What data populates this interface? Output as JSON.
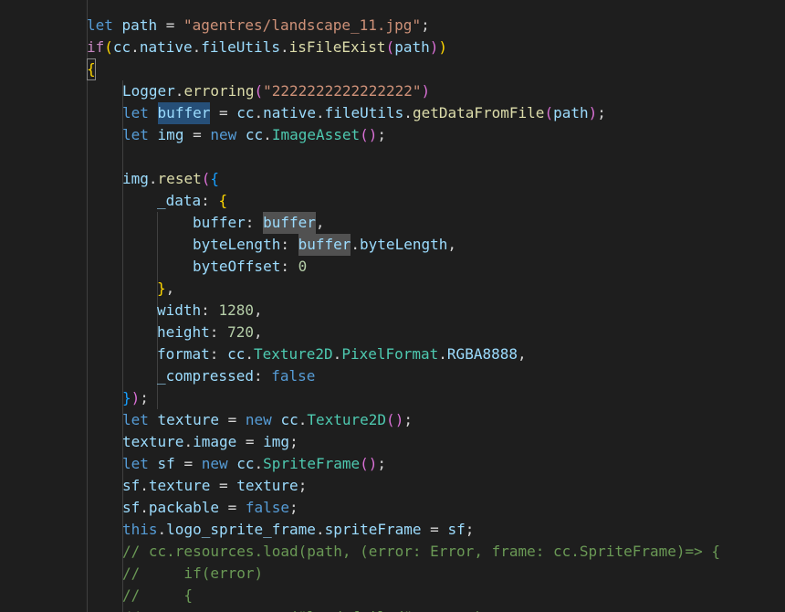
{
  "editor": {
    "background": "#1e1e1e",
    "lines": [
      {
        "indent": 1,
        "tokens": [
          [
            "let",
            "kw"
          ],
          [
            " ",
            "pun"
          ],
          [
            "path",
            "var"
          ],
          [
            " = ",
            "pun"
          ],
          [
            "\"agentres/landscape_11.jpg\"",
            "str"
          ],
          [
            ";",
            "pun"
          ]
        ]
      },
      {
        "indent": 1,
        "tokens": [
          [
            "if",
            "ctl"
          ],
          [
            "(",
            "br1"
          ],
          [
            "cc",
            "var"
          ],
          [
            ".",
            "pun"
          ],
          [
            "native",
            "var"
          ],
          [
            ".",
            "pun"
          ],
          [
            "fileUtils",
            "var"
          ],
          [
            ".",
            "pun"
          ],
          [
            "isFileExist",
            "fn"
          ],
          [
            "(",
            "br2"
          ],
          [
            "path",
            "var"
          ],
          [
            ")",
            "br2"
          ],
          [
            ")",
            "br1"
          ]
        ]
      },
      {
        "indent": 1,
        "tokens": [
          [
            "{",
            "br1 brace-box"
          ]
        ]
      },
      {
        "indent": 2,
        "tokens": [
          [
            "Logger",
            "var"
          ],
          [
            ".",
            "pun"
          ],
          [
            "erroring",
            "fn"
          ],
          [
            "(",
            "br2"
          ],
          [
            "\"2222222222222222\"",
            "str"
          ],
          [
            ")",
            "br2"
          ]
        ]
      },
      {
        "indent": 2,
        "tokens": [
          [
            "let",
            "kw"
          ],
          [
            " ",
            "pun"
          ],
          [
            "buffer",
            "var hl-sel"
          ],
          [
            " = ",
            "pun"
          ],
          [
            "cc",
            "var"
          ],
          [
            ".",
            "pun"
          ],
          [
            "native",
            "var"
          ],
          [
            ".",
            "pun"
          ],
          [
            "fileUtils",
            "var"
          ],
          [
            ".",
            "pun"
          ],
          [
            "getDataFromFile",
            "fn"
          ],
          [
            "(",
            "br2"
          ],
          [
            "path",
            "var"
          ],
          [
            ")",
            "br2"
          ],
          [
            ";",
            "pun"
          ]
        ]
      },
      {
        "indent": 2,
        "tokens": [
          [
            "let",
            "kw"
          ],
          [
            " ",
            "pun"
          ],
          [
            "img",
            "var"
          ],
          [
            " = ",
            "pun"
          ],
          [
            "new",
            "kw"
          ],
          [
            " ",
            "pun"
          ],
          [
            "cc",
            "var"
          ],
          [
            ".",
            "pun"
          ],
          [
            "ImageAsset",
            "cls"
          ],
          [
            "(",
            "br2"
          ],
          [
            ")",
            "br2"
          ],
          [
            ";",
            "pun"
          ]
        ]
      },
      {
        "indent": 2,
        "tokens": []
      },
      {
        "indent": 2,
        "tokens": [
          [
            "img",
            "var"
          ],
          [
            ".",
            "pun"
          ],
          [
            "reset",
            "fn"
          ],
          [
            "(",
            "br2"
          ],
          [
            "{",
            "br3"
          ]
        ]
      },
      {
        "indent": 3,
        "tokens": [
          [
            "_data",
            "var"
          ],
          [
            ": ",
            "pun"
          ],
          [
            "{",
            "br1"
          ]
        ]
      },
      {
        "indent": 4,
        "tokens": [
          [
            "buffer",
            "var"
          ],
          [
            ": ",
            "pun"
          ],
          [
            "buffer",
            "var hl-occ"
          ],
          [
            ",",
            "pun"
          ]
        ]
      },
      {
        "indent": 4,
        "tokens": [
          [
            "byteLength",
            "var"
          ],
          [
            ": ",
            "pun"
          ],
          [
            "buffer",
            "var hl-occ"
          ],
          [
            ".",
            "pun"
          ],
          [
            "byteLength",
            "var"
          ],
          [
            ",",
            "pun"
          ]
        ]
      },
      {
        "indent": 4,
        "tokens": [
          [
            "byteOffset",
            "var"
          ],
          [
            ": ",
            "pun"
          ],
          [
            "0",
            "num"
          ]
        ]
      },
      {
        "indent": 3,
        "tokens": [
          [
            "}",
            "br1"
          ],
          [
            ",",
            "pun"
          ]
        ]
      },
      {
        "indent": 3,
        "tokens": [
          [
            "width",
            "var"
          ],
          [
            ": ",
            "pun"
          ],
          [
            "1280",
            "num"
          ],
          [
            ",",
            "pun"
          ]
        ]
      },
      {
        "indent": 3,
        "tokens": [
          [
            "height",
            "var"
          ],
          [
            ": ",
            "pun"
          ],
          [
            "720",
            "num"
          ],
          [
            ",",
            "pun"
          ]
        ]
      },
      {
        "indent": 3,
        "tokens": [
          [
            "format",
            "var"
          ],
          [
            ": ",
            "pun"
          ],
          [
            "cc",
            "var"
          ],
          [
            ".",
            "pun"
          ],
          [
            "Texture2D",
            "cls"
          ],
          [
            ".",
            "pun"
          ],
          [
            "PixelFormat",
            "cls"
          ],
          [
            ".",
            "pun"
          ],
          [
            "RGBA8888",
            "var"
          ],
          [
            ",",
            "pun"
          ]
        ]
      },
      {
        "indent": 3,
        "tokens": [
          [
            "_compressed",
            "var"
          ],
          [
            ": ",
            "pun"
          ],
          [
            "false",
            "kw"
          ]
        ]
      },
      {
        "indent": 2,
        "tokens": [
          [
            "}",
            "br3"
          ],
          [
            ")",
            "br2"
          ],
          [
            ";",
            "pun"
          ]
        ]
      },
      {
        "indent": 2,
        "tokens": [
          [
            "let",
            "kw"
          ],
          [
            " ",
            "pun"
          ],
          [
            "texture",
            "var"
          ],
          [
            " = ",
            "pun"
          ],
          [
            "new",
            "kw"
          ],
          [
            " ",
            "pun"
          ],
          [
            "cc",
            "var"
          ],
          [
            ".",
            "pun"
          ],
          [
            "Texture2D",
            "cls"
          ],
          [
            "(",
            "br2"
          ],
          [
            ")",
            "br2"
          ],
          [
            ";",
            "pun"
          ]
        ]
      },
      {
        "indent": 2,
        "tokens": [
          [
            "texture",
            "var"
          ],
          [
            ".",
            "pun"
          ],
          [
            "image",
            "var"
          ],
          [
            " = ",
            "pun"
          ],
          [
            "img",
            "var"
          ],
          [
            ";",
            "pun"
          ]
        ]
      },
      {
        "indent": 2,
        "tokens": [
          [
            "let",
            "kw"
          ],
          [
            " ",
            "pun"
          ],
          [
            "sf",
            "var"
          ],
          [
            " = ",
            "pun"
          ],
          [
            "new",
            "kw"
          ],
          [
            " ",
            "pun"
          ],
          [
            "cc",
            "var"
          ],
          [
            ".",
            "pun"
          ],
          [
            "SpriteFrame",
            "cls"
          ],
          [
            "(",
            "br2"
          ],
          [
            ")",
            "br2"
          ],
          [
            ";",
            "pun"
          ]
        ]
      },
      {
        "indent": 2,
        "tokens": [
          [
            "sf",
            "var"
          ],
          [
            ".",
            "pun"
          ],
          [
            "texture",
            "var"
          ],
          [
            " = ",
            "pun"
          ],
          [
            "texture",
            "var"
          ],
          [
            ";",
            "pun"
          ]
        ]
      },
      {
        "indent": 2,
        "tokens": [
          [
            "sf",
            "var"
          ],
          [
            ".",
            "pun"
          ],
          [
            "packable",
            "var"
          ],
          [
            " = ",
            "pun"
          ],
          [
            "false",
            "kw"
          ],
          [
            ";",
            "pun"
          ]
        ]
      },
      {
        "indent": 2,
        "tokens": [
          [
            "this",
            "kw"
          ],
          [
            ".",
            "pun"
          ],
          [
            "logo_sprite_frame",
            "var"
          ],
          [
            ".",
            "pun"
          ],
          [
            "spriteFrame",
            "var"
          ],
          [
            " = ",
            "pun"
          ],
          [
            "sf",
            "var"
          ],
          [
            ";",
            "pun"
          ]
        ]
      },
      {
        "indent": 2,
        "tokens": [
          [
            "// cc.resources.load(path, (error: Error, frame: cc.SpriteFrame)=> {",
            "cmt"
          ]
        ]
      },
      {
        "indent": 2,
        "tokens": [
          [
            "//     if(error)",
            "cmt"
          ]
        ]
      },
      {
        "indent": 2,
        "tokens": [
          [
            "//     {",
            "cmt"
          ]
        ]
      },
      {
        "indent": 2,
        "tokens": [
          [
            "//         cc.error(\"load failed\", error);",
            "cmt"
          ]
        ]
      }
    ]
  }
}
